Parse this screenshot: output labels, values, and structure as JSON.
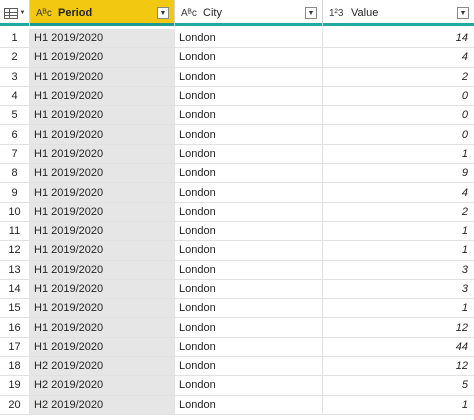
{
  "columns": [
    {
      "type_icon": "Aᴮᴄ",
      "name": "Period"
    },
    {
      "type_icon": "Aᴮᴄ",
      "name": "City"
    },
    {
      "type_icon": "1²3",
      "name": "Value"
    }
  ],
  "rows": [
    {
      "index": "1",
      "period": "H1 2019/2020",
      "city": "London",
      "value": "14"
    },
    {
      "index": "2",
      "period": "H1 2019/2020",
      "city": "London",
      "value": "4"
    },
    {
      "index": "3",
      "period": "H1 2019/2020",
      "city": "London",
      "value": "2"
    },
    {
      "index": "4",
      "period": "H1 2019/2020",
      "city": "London",
      "value": "0"
    },
    {
      "index": "5",
      "period": "H1 2019/2020",
      "city": "London",
      "value": "0"
    },
    {
      "index": "6",
      "period": "H1 2019/2020",
      "city": "London",
      "value": "0"
    },
    {
      "index": "7",
      "period": "H1 2019/2020",
      "city": "London",
      "value": "1"
    },
    {
      "index": "8",
      "period": "H1 2019/2020",
      "city": "London",
      "value": "9"
    },
    {
      "index": "9",
      "period": "H1 2019/2020",
      "city": "London",
      "value": "4"
    },
    {
      "index": "10",
      "period": "H1 2019/2020",
      "city": "London",
      "value": "2"
    },
    {
      "index": "11",
      "period": "H1 2019/2020",
      "city": "London",
      "value": "1"
    },
    {
      "index": "12",
      "period": "H1 2019/2020",
      "city": "London",
      "value": "1"
    },
    {
      "index": "13",
      "period": "H1 2019/2020",
      "city": "London",
      "value": "3"
    },
    {
      "index": "14",
      "period": "H1 2019/2020",
      "city": "London",
      "value": "3"
    },
    {
      "index": "15",
      "period": "H1 2019/2020",
      "city": "London",
      "value": "1"
    },
    {
      "index": "16",
      "period": "H1 2019/2020",
      "city": "London",
      "value": "12"
    },
    {
      "index": "17",
      "period": "H1 2019/2020",
      "city": "London",
      "value": "44"
    },
    {
      "index": "18",
      "period": "H2 2019/2020",
      "city": "London",
      "value": "12"
    },
    {
      "index": "19",
      "period": "H2 2019/2020",
      "city": "London",
      "value": "5"
    },
    {
      "index": "20",
      "period": "H2 2019/2020",
      "city": "London",
      "value": "1"
    }
  ],
  "colors": {
    "selected_header": "#f2c811",
    "header_bar": "#21a9a0",
    "selected_column_bg": "#e6e6e6"
  }
}
